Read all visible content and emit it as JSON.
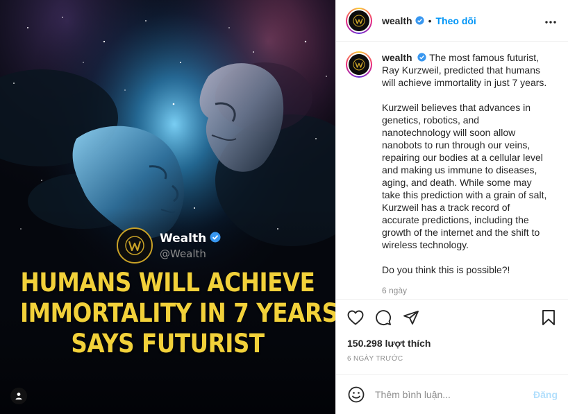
{
  "media": {
    "brand_name": "Wealth",
    "brand_handle": "@Wealth",
    "headline_lines": [
      "HUMANS WILL ACHIEVE",
      "IMMORTALITY IN 7 YEARS,",
      "SAYS FUTURIST"
    ],
    "headline_color": "#f2d13a",
    "tag_icon": "user-tag-icon"
  },
  "header": {
    "username": "wealth",
    "separator": "•",
    "follow_label": "Theo dõi",
    "more_icon": "more-horizontal-icon",
    "verified_icon": "verified-badge-icon"
  },
  "caption": {
    "username": "wealth",
    "paragraphs": [
      "The most famous futurist, Ray Kurzweil, predicted that humans will achieve immortality in just 7 years.",
      "Kurzweil believes that advances in genetics, robotics, and nanotechnology will soon allow nanobots to run through our veins, repairing our bodies at a cellular level and making us immune to diseases, aging, and death. While some may take this prediction with a grain of salt, Kurzweil has a track record of accurate predictions, including the growth of the internet and the shift to wireless technology.",
      "Do you think this is possible?!"
    ],
    "time": "6 ngày"
  },
  "actions": {
    "like_icon": "heart-icon",
    "comment_icon": "comment-icon",
    "share_icon": "send-icon",
    "save_icon": "bookmark-icon"
  },
  "likes_text": "150.298 lượt thích",
  "date_text": "6 NGÀY TRƯỚC",
  "comment_box": {
    "emoji_icon": "emoji-icon",
    "placeholder": "Thêm bình luận...",
    "post_label": "Đăng"
  },
  "colors": {
    "accent": "#0095f6",
    "post_disabled": "#b2dffc",
    "brand_gold": "#c9a227"
  }
}
